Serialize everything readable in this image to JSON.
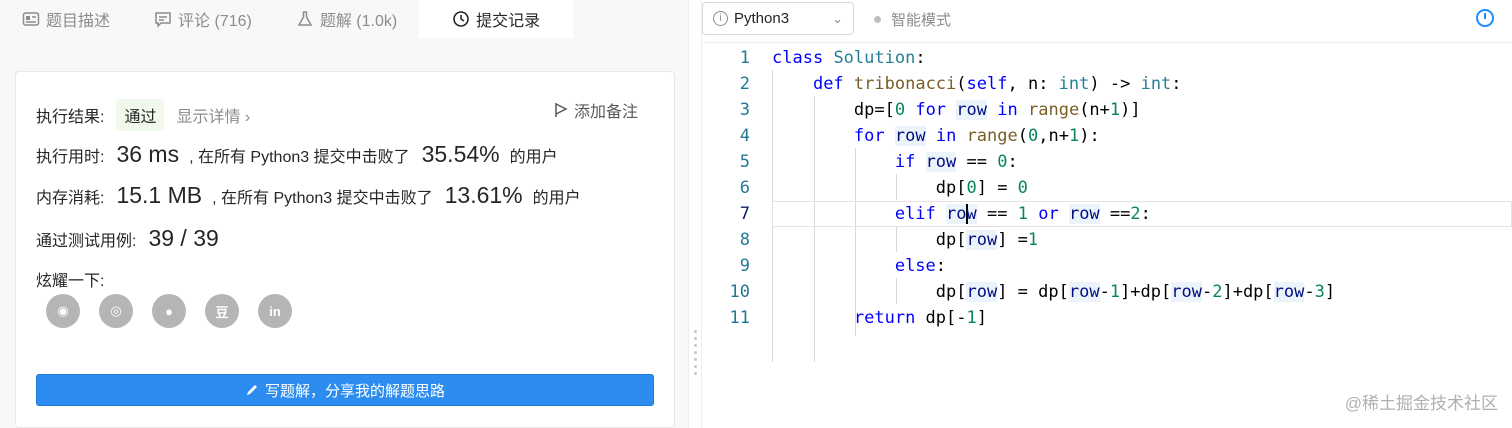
{
  "tabs": [
    {
      "label": "题目描述",
      "icon": "description-icon"
    },
    {
      "label": "评论 (716)",
      "icon": "comment-icon"
    },
    {
      "label": "题解 (1.0k)",
      "icon": "flask-icon"
    },
    {
      "label": "提交记录",
      "icon": "clock-icon"
    }
  ],
  "result": {
    "label": "执行结果:",
    "status": "通过",
    "detail_link": "显示详情 ›",
    "add_note": "添加备注",
    "time_label": "执行用时:",
    "time_value": "36 ms",
    "time_text": ", 在所有 Python3 提交中击败了",
    "time_percent": "35.54%",
    "time_suffix": "的用户",
    "mem_label": "内存消耗:",
    "mem_value": "15.1 MB",
    "mem_text": ", 在所有 Python3 提交中击败了",
    "mem_percent": "13.61%",
    "mem_suffix": "的用户",
    "tests_label": "通过测试用例:",
    "tests_value": "39 / 39",
    "share_label": "炫耀一下:",
    "share_icons": [
      "wechat-icon",
      "weibo-icon",
      "qq-icon",
      "douban-icon",
      "linkedin-icon"
    ],
    "share_glyphs": [
      "◉",
      "◎",
      "●",
      "豆",
      "in"
    ],
    "write_button": "写题解，分享我的解题思路"
  },
  "editor_toolbar": {
    "language": "Python3",
    "mode": "智能模式"
  },
  "code_lines": [
    {
      "no": "1"
    },
    {
      "no": "2"
    },
    {
      "no": "3"
    },
    {
      "no": "4"
    },
    {
      "no": "5"
    },
    {
      "no": "6"
    },
    {
      "no": "7"
    },
    {
      "no": "8"
    },
    {
      "no": "9"
    },
    {
      "no": "10"
    },
    {
      "no": "11"
    }
  ],
  "watermark": "@稀土掘金技术社区"
}
